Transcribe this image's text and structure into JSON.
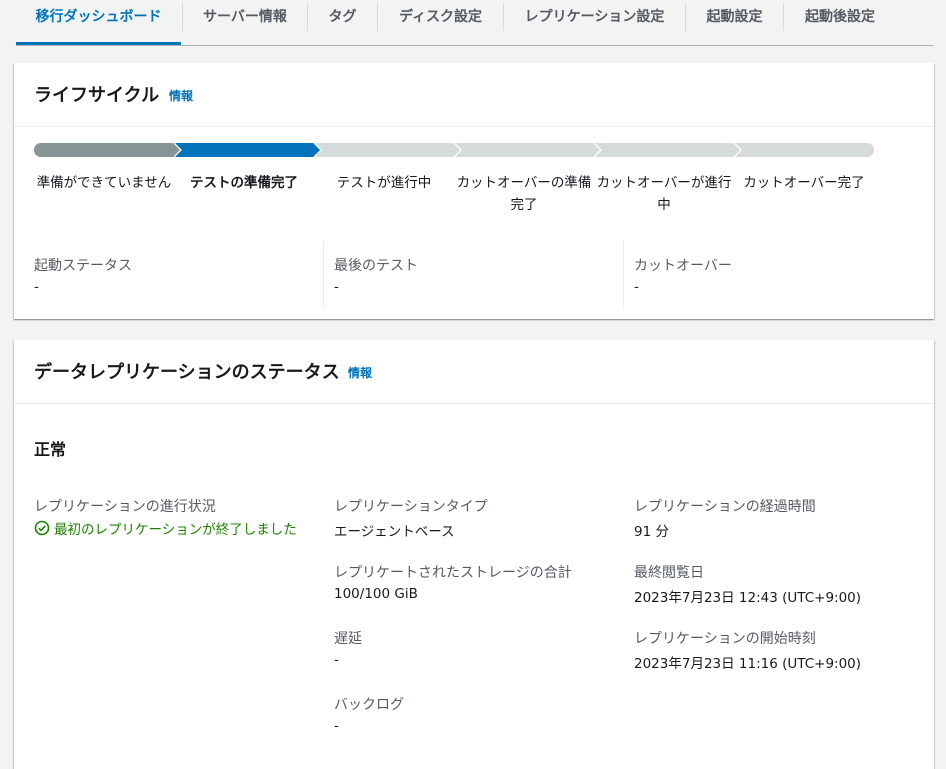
{
  "tabs": [
    {
      "label": "移行ダッシュボード",
      "active": true
    },
    {
      "label": "サーバー情報"
    },
    {
      "label": "タグ"
    },
    {
      "label": "ディスク設定"
    },
    {
      "label": "レプリケーション設定"
    },
    {
      "label": "起動設定"
    },
    {
      "label": "起動後設定"
    }
  ],
  "lifecycle": {
    "title": "ライフサイクル",
    "info_label": "情報",
    "stages": [
      {
        "label": "準備ができていません",
        "state": "complete"
      },
      {
        "label": "テストの準備完了",
        "state": "current"
      },
      {
        "label": "テストが進行中",
        "state": "pending"
      },
      {
        "label": "カットオーバーの準備完了",
        "state": "pending"
      },
      {
        "label": "カットオーバーが進行中",
        "state": "pending"
      },
      {
        "label": "カットオーバー完了",
        "state": "pending"
      }
    ],
    "colors": {
      "complete": "#879596",
      "current": "#0073bb",
      "pending": "#d5dbdb"
    },
    "fields": [
      {
        "label": "起動ステータス",
        "value": "-"
      },
      {
        "label": "最後のテスト",
        "value": "-"
      },
      {
        "label": "カットオーバー",
        "value": "-"
      }
    ]
  },
  "replication": {
    "title": "データレプリケーションのステータス",
    "info_label": "情報",
    "health": "正常",
    "progress_label": "レプリケーションの進行状況",
    "progress_value": "最初のレプリケーションが終了しました",
    "progress_color": "#1d8102",
    "type_label": "レプリケーションタイプ",
    "type_value": "エージェントベース",
    "storage_label": "レプリケートされたストレージの合計",
    "storage_value": "100/100 GiB",
    "lag_label": "遅延",
    "lag_value": "-",
    "backlog_label": "バックログ",
    "backlog_value": "-",
    "elapsed_label": "レプリケーションの経過時間",
    "elapsed_value": "91 分",
    "last_seen_label": "最終閲覧日",
    "last_seen_value": "2023年7月23日 12:43 (UTC+9:00)",
    "start_label": "レプリケーションの開始時刻",
    "start_value": "2023年7月23日 11:16 (UTC+9:00)"
  }
}
